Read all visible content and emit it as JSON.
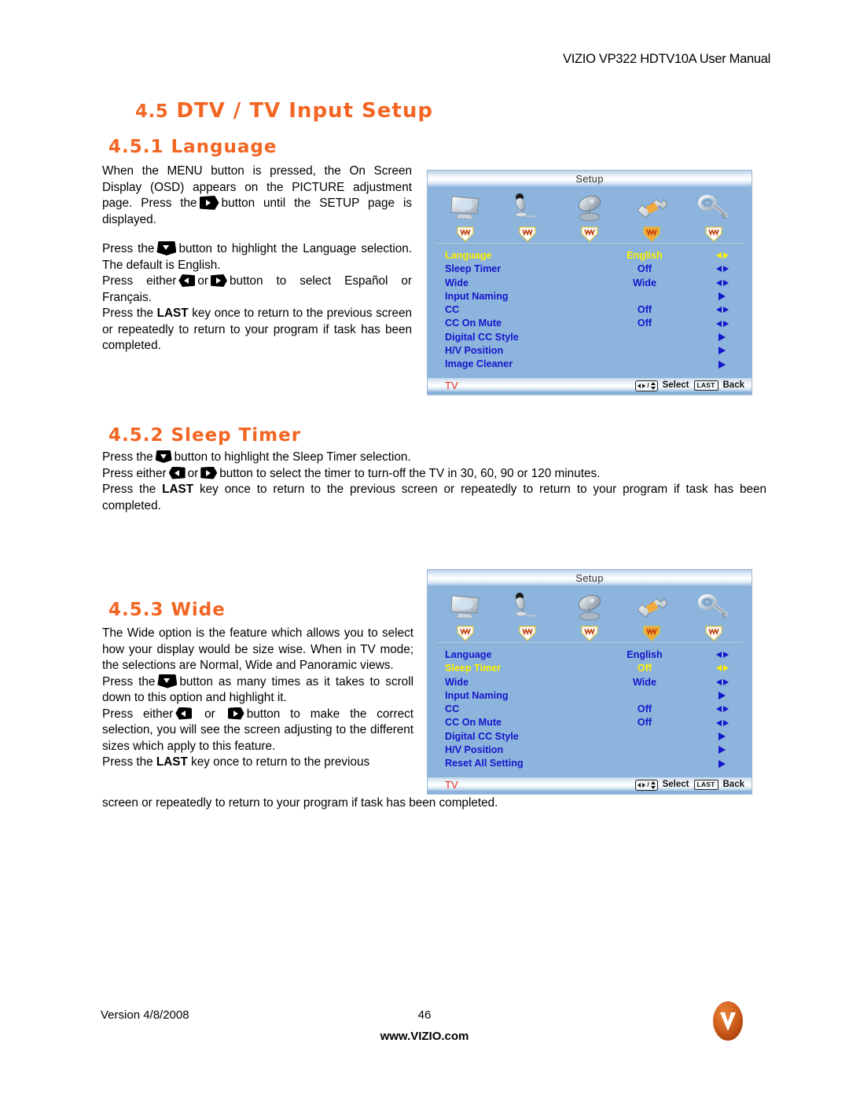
{
  "header": {
    "title": "VIZIO VP322 HDTV10A User Manual"
  },
  "headings": {
    "section_number": "4.5",
    "section_title": "DTV / TV Input Setup",
    "sub_451": "4.5.1 Language",
    "sub_452": "4.5.2 Sleep Timer",
    "sub_453": "4.5.3 Wide"
  },
  "body_451": {
    "p1_a": "When the MENU button is pressed, the On Screen Display (OSD) appears on the PICTURE adjustment page.  Press the",
    "p1_b": "button until the SETUP page is displayed.",
    "p2_a": "Press the",
    "p2_b": "button to highlight the Language selection.  The default is English.",
    "p3_a": "Press either",
    "p3_or": "or",
    "p3_b": "button to select Español or Français.",
    "p4_a": "Press the",
    "p4_key": "LAST",
    "p4_b": "key once to return to the previous screen or repeatedly to return to your program if task has been completed."
  },
  "body_452": {
    "p1_a": "Press the",
    "p1_b": "button to highlight the Sleep Timer selection.",
    "p2_a": "Press either",
    "p2_or": "or",
    "p2_b": "button to select the timer to turn-off the TV in 30, 60, 90 or 120 minutes.",
    "p3_a": "Press the",
    "p3_key": "LAST",
    "p3_b": "key once to return to the previous screen or repeatedly to return to your program if task has been completed."
  },
  "body_453": {
    "p1": "The Wide option is the feature which allows you to select how your display would be size wise. When in TV mode; the selections are Normal, Wide and Panoramic views.",
    "p2_a": "Press the",
    "p2_b": "button as many times as it takes to scroll down to this option and highlight it.",
    "p3_a": "Press either",
    "p3_or": "or",
    "p3_b": "button to make the correct selection, you will see the screen adjusting to the different sizes which apply to this feature.",
    "p4_a": "Press the",
    "p4_key": "LAST",
    "p4_b": "key once to return to the previous",
    "p4_c": "screen or repeatedly to return to your program if task has been completed."
  },
  "osd_common": {
    "title": "Setup",
    "tabs": [
      {
        "name": "picture-icon",
        "active": false
      },
      {
        "name": "audio-icon",
        "active": false
      },
      {
        "name": "tuner-icon",
        "active": false
      },
      {
        "name": "setup-icon",
        "active": true
      },
      {
        "name": "parental-icon",
        "active": false
      }
    ],
    "footer": {
      "source_label": "TV",
      "select_label": "Select",
      "last_key": "LAST",
      "back_label": "Back"
    }
  },
  "osd_1": {
    "rows": [
      {
        "label": "Language",
        "value": "English",
        "arrow": "double",
        "selected": true
      },
      {
        "label": "Sleep Timer",
        "value": "Off",
        "arrow": "double",
        "selected": false
      },
      {
        "label": "Wide",
        "value": "Wide",
        "arrow": "double",
        "selected": false
      },
      {
        "label": "Input Naming",
        "value": "",
        "arrow": "single",
        "selected": false
      },
      {
        "label": "CC",
        "value": "Off",
        "arrow": "double",
        "selected": false
      },
      {
        "label": "CC On Mute",
        "value": "Off",
        "arrow": "double",
        "selected": false
      },
      {
        "label": "Digital CC Style",
        "value": "",
        "arrow": "single",
        "selected": false
      },
      {
        "label": "H/V Position",
        "value": "",
        "arrow": "single",
        "selected": false
      },
      {
        "label": "Image Cleaner",
        "value": "",
        "arrow": "single",
        "selected": false
      }
    ]
  },
  "osd_2": {
    "rows": [
      {
        "label": "Language",
        "value": "English",
        "arrow": "double",
        "selected": false
      },
      {
        "label": "Sleep Timer",
        "value": "Off",
        "arrow": "double",
        "selected": true
      },
      {
        "label": "Wide",
        "value": "Wide",
        "arrow": "double",
        "selected": false
      },
      {
        "label": "Input Naming",
        "value": "",
        "arrow": "single",
        "selected": false
      },
      {
        "label": "CC",
        "value": "Off",
        "arrow": "double",
        "selected": false
      },
      {
        "label": "CC On Mute",
        "value": "Off",
        "arrow": "double",
        "selected": false
      },
      {
        "label": "Digital CC Style",
        "value": "",
        "arrow": "single",
        "selected": false
      },
      {
        "label": "H/V Position",
        "value": "",
        "arrow": "single",
        "selected": false
      },
      {
        "label": "Reset All Setting",
        "value": "",
        "arrow": "single",
        "selected": false
      }
    ]
  },
  "footer": {
    "version": "Version 4/8/2008",
    "page_number": "46",
    "url": "www.VIZIO.com",
    "logo_letter": "V"
  },
  "colors": {
    "accent_orange": "#F26522",
    "osd_background": "#8CB4DC",
    "osd_text_blue": "#1515CC",
    "osd_highlight_yellow": "#FFF000",
    "osd_source_red": "#E8271C"
  }
}
